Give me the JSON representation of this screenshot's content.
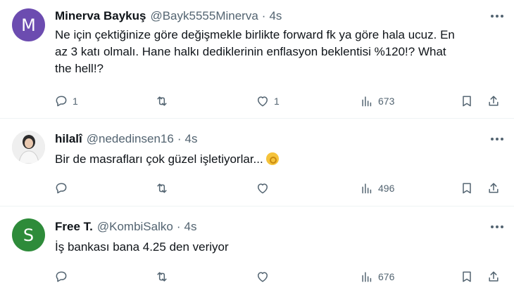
{
  "tweets": [
    {
      "avatar_letter": "M",
      "avatar_color": "#6c4cb0",
      "name": "Minerva Baykuş",
      "handle": "@Bayk5555Minerva",
      "separator": "·",
      "time": "4s",
      "text_lines": [
        "Ne için çektiğinize göre değişmekle birlikte forward fk ya göre hala ucuz. En",
        "az 3 katı olmalı. Hane halkı dediklerinin enflasyon beklentisi %120!? What",
        "the hell!?"
      ],
      "replies": "1",
      "retweets": "",
      "likes": "1",
      "views": "673"
    },
    {
      "avatar_letter": "",
      "avatar_color": "#d9d9d9",
      "name": "hilalî",
      "handle": "@nededinsen16",
      "separator": "·",
      "time": "4s",
      "text_lines": [
        "Bir de masrafları çok güzel işletiyorlar..."
      ],
      "emoji": "ok-hand-emoji",
      "replies": "",
      "retweets": "",
      "likes": "",
      "views": "496"
    },
    {
      "avatar_letter": "S",
      "avatar_color": "#2e8b3a",
      "name": "Free T.",
      "handle": "@KombiSalko",
      "separator": "·",
      "time": "4s",
      "text_lines": [
        "İş bankası bana 4.25 den veriyor"
      ],
      "replies": "",
      "retweets": "",
      "likes": "",
      "views": "676"
    }
  ]
}
